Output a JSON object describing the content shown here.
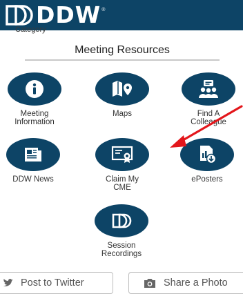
{
  "header": {
    "brand": "DDW",
    "registered_mark": "®",
    "category_label": "Category"
  },
  "section": {
    "title": "Meeting Resources"
  },
  "tiles": [
    {
      "label": "Meeting\nInformation",
      "icon": "info-icon"
    },
    {
      "label": "Maps",
      "icon": "map-pin-icon"
    },
    {
      "label": "Find A\nColleague",
      "icon": "people-icon"
    },
    {
      "label": "DDW News",
      "icon": "newspaper-icon"
    },
    {
      "label": "Claim My\nCME",
      "icon": "certificate-icon"
    },
    {
      "label": "ePosters",
      "icon": "eposter-icon"
    },
    {
      "label": "Session\nRecordings",
      "icon": "ddw-logo-icon"
    }
  ],
  "share": {
    "twitter_label": "Post to Twitter",
    "photo_label": "Share a Photo"
  },
  "colors": {
    "brand_navy": "#0d4466",
    "annotation_arrow": "#e3161b"
  }
}
